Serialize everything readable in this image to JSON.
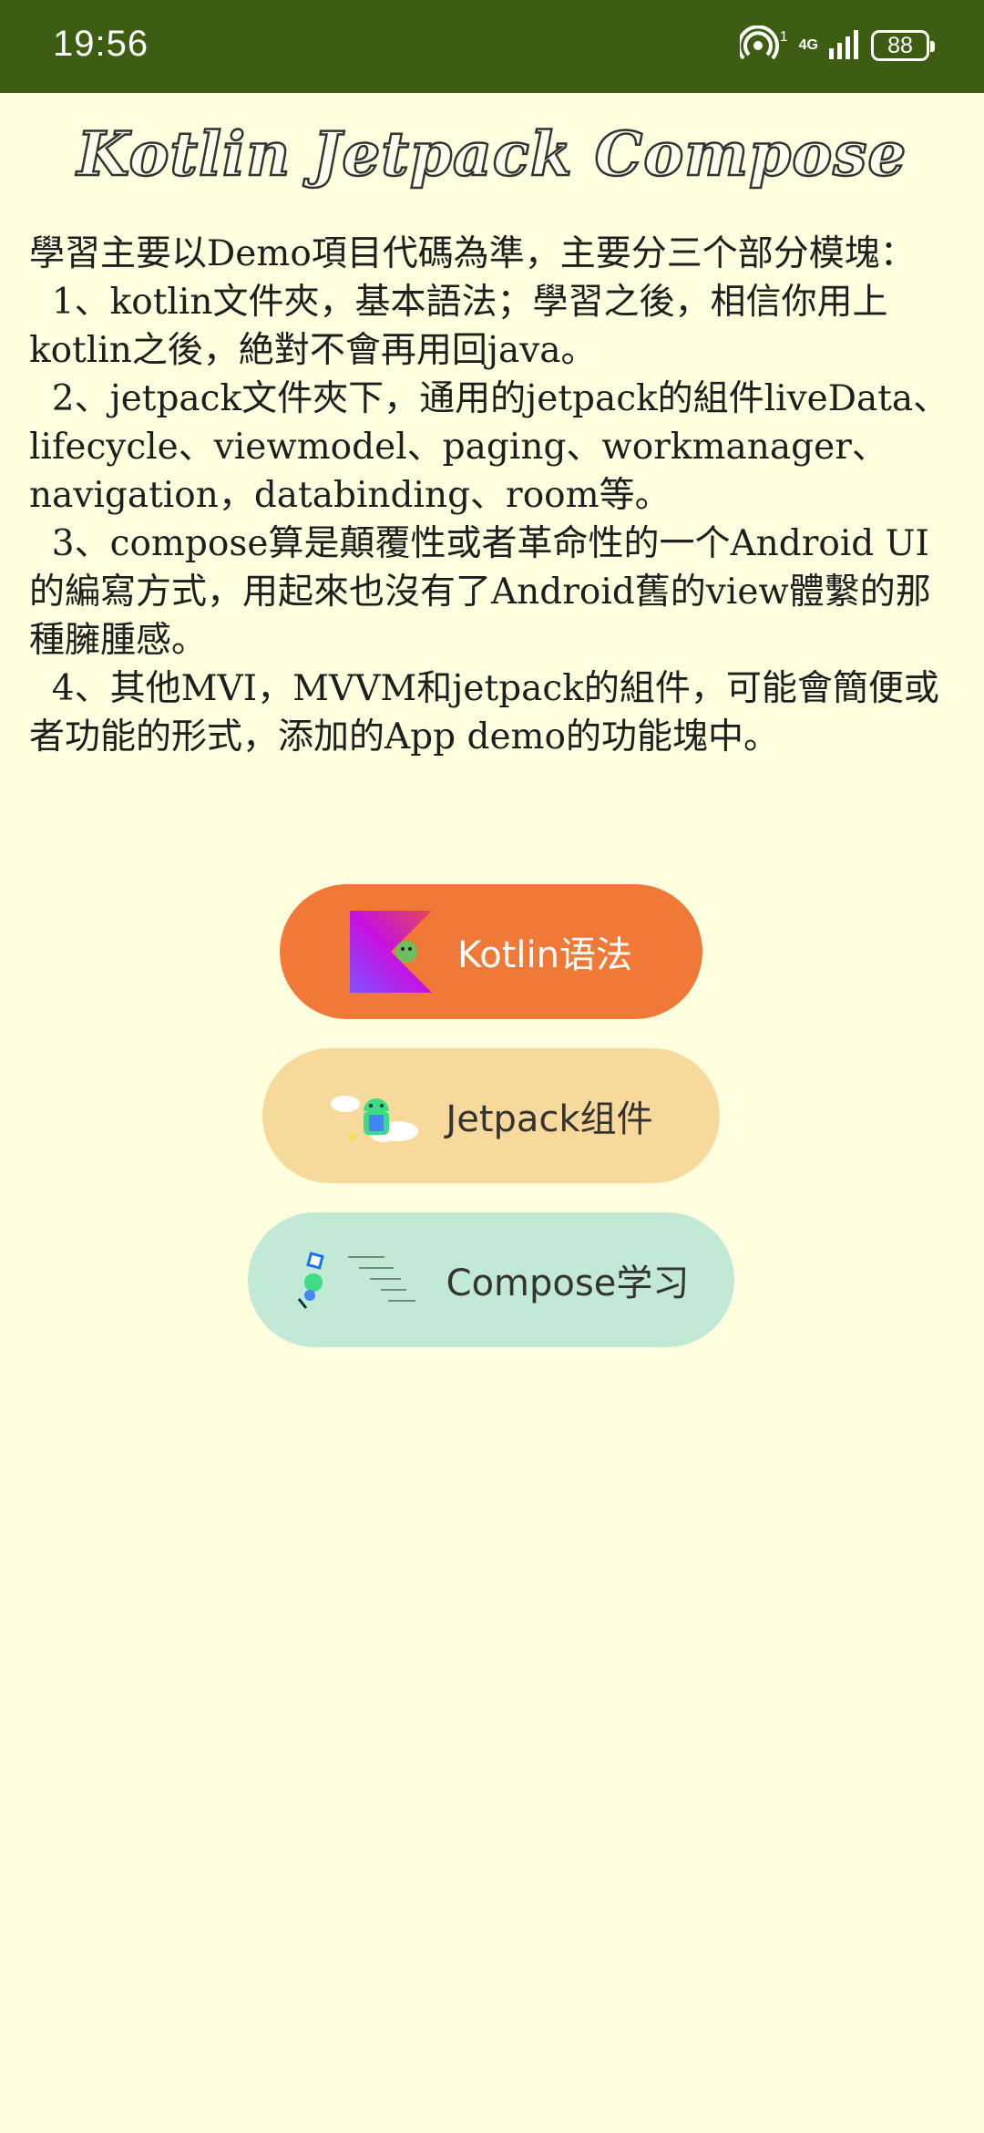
{
  "status_bar": {
    "time": "19:56",
    "network": "4G",
    "battery": "88",
    "hotspot_count": "1"
  },
  "title": "Kotlin Jetpack Compose",
  "intro": {
    "heading": "學習主要以Demo項目代碼為準，主要分三个部分模塊：",
    "item1": "  1、kotlin文件夾，基本語法；學習之後，相信你用上kotlin之後，絶對不會再用回java。",
    "item2": "  2、jetpack文件夾下，通用的jetpack的組件liveData、lifecycle、viewmodel、paging、workmanager、navigation，databinding、room等。",
    "item3": "  3、compose算是顛覆性或者革命性的一个Android UI的編寫方式，用起來也沒有了Android舊的view體繫的那種臃腫感。",
    "item4": "  4、其他MVI，MVVM和jetpack的組件，可能會簡便或者功能的形式，添加的App demo的功能塊中。"
  },
  "buttons": {
    "kotlin": {
      "label": "Kotlin语法",
      "icon": "kotlin-logo-icon",
      "color": "#f07938"
    },
    "jetpack": {
      "label": "Jetpack组件",
      "icon": "jetpack-android-clouds-icon",
      "color": "#f7d99c"
    },
    "compose": {
      "label": "Compose学习",
      "icon": "compose-rocket-icon",
      "color": "#c2e8d6"
    }
  },
  "colors": {
    "status_bar": "#3d5e12",
    "background": "#ffffe0"
  }
}
